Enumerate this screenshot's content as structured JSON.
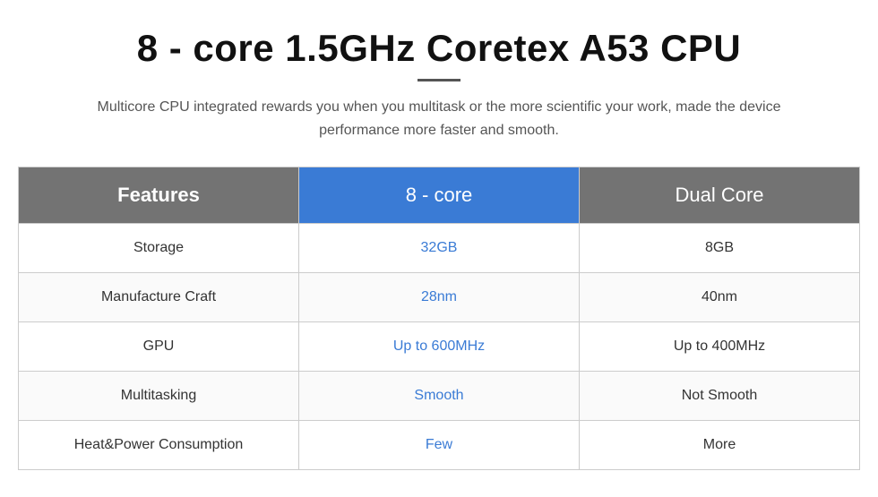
{
  "header": {
    "title": "8 - core 1.5GHz Coretex A53 CPU",
    "subtitle": "Multicore CPU integrated rewards you when you multitask or the more scientific your work, made the device performance more faster and smooth."
  },
  "table": {
    "columns": {
      "features": "Features",
      "col8core": "8 - core",
      "dualcore": "Dual Core"
    },
    "rows": [
      {
        "feature": "Storage",
        "val_8core": "32GB",
        "val_dual": "8GB"
      },
      {
        "feature": "Manufacture Craft",
        "val_8core": "28nm",
        "val_dual": "40nm"
      },
      {
        "feature": "GPU",
        "val_8core": "Up to 600MHz",
        "val_dual": "Up to 400MHz"
      },
      {
        "feature": "Multitasking",
        "val_8core": "Smooth",
        "val_dual": "Not Smooth"
      },
      {
        "feature": "Heat&Power Consumption",
        "val_8core": "Few",
        "val_dual": "More"
      }
    ]
  }
}
